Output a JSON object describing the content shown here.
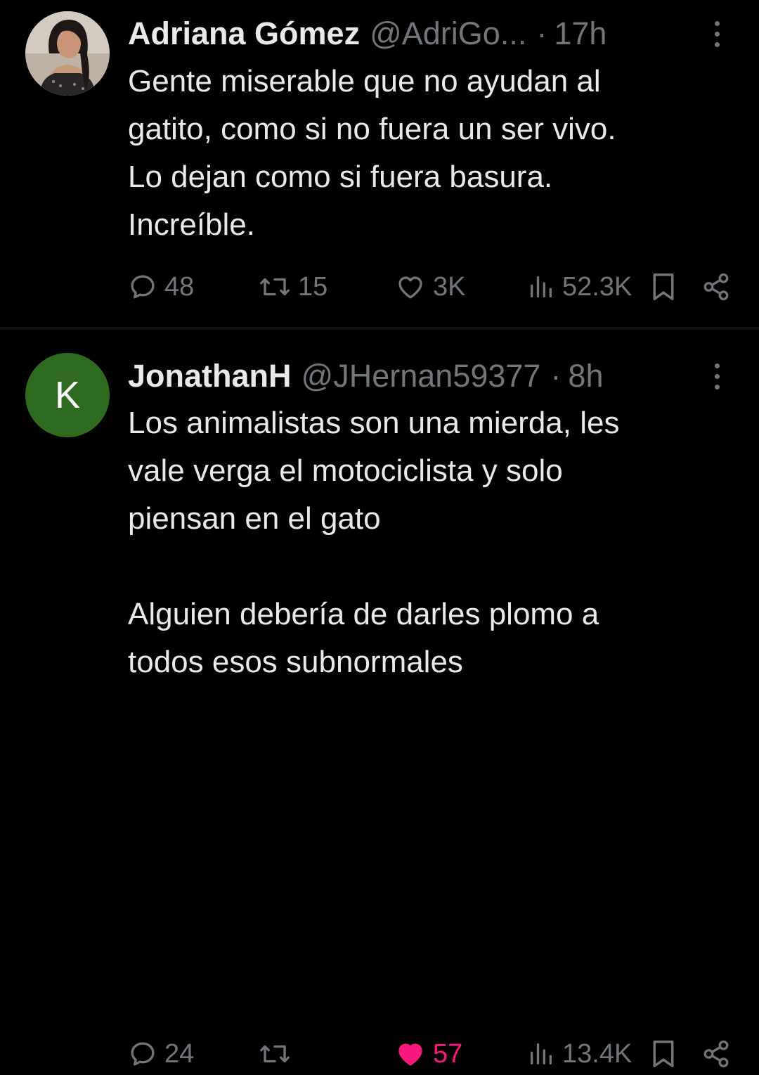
{
  "tweets": [
    {
      "name": "Adriana Gómez",
      "handle": "@AdriGo...",
      "separator": "·",
      "time": "17h",
      "text": [
        "Gente miserable que no ayudan al",
        "gatito, como si no fuera un ser vivo.",
        "Lo dejan como si fuera basura.",
        "Increíble."
      ],
      "replies": "48",
      "retweets": "15",
      "likes": "3K",
      "views": "52.3K",
      "liked": false
    },
    {
      "name": "JonathanH",
      "handle": "@JHernan59377",
      "separator": "·",
      "time": "8h",
      "avatar_letter": "K",
      "avatar_color": "#2e6b1e",
      "text": [
        "Los animalistas son una mierda, les",
        "vale verga el motociclista y solo",
        "piensan en el gato",
        "",
        "Alguien debería de darles plomo a",
        "todos esos subnormales"
      ],
      "replies": "24",
      "retweets": "",
      "likes": "57",
      "views": "13.4K",
      "liked": true
    }
  ],
  "colors": {
    "background": "#000000",
    "text": "#e7e9ea",
    "muted": "#71767b",
    "like": "#f91880",
    "divider": "#2f3336"
  },
  "icons": [
    "reply-icon",
    "retweet-icon",
    "heart-icon",
    "views-icon",
    "bookmark-icon",
    "share-icon",
    "more-icon"
  ]
}
